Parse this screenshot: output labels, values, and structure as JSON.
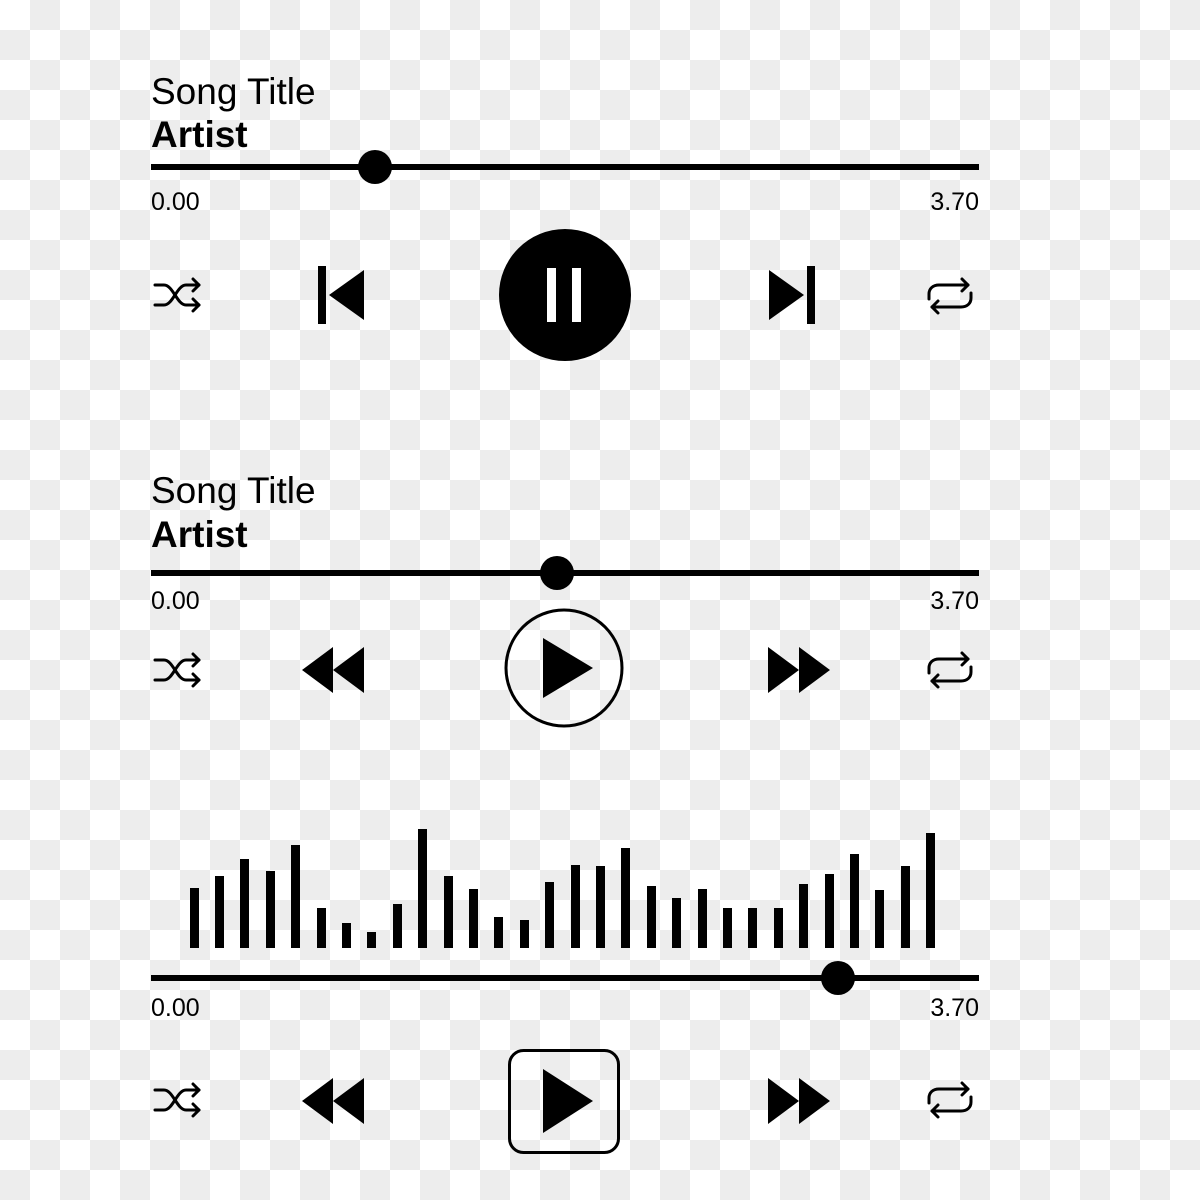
{
  "colors": {
    "ink": "#000000",
    "on_ink": "#ffffff",
    "checker_light": "#ffffff",
    "checker_dark": "#ededed"
  },
  "players": [
    {
      "title": "Song Title",
      "artist": "Artist",
      "time_start": "0.00",
      "time_end": "3.70",
      "progress": 0.27,
      "icons": {
        "shuffle": "shuffle-icon",
        "previous": "skip-previous-icon",
        "main": "pause-icon",
        "next": "skip-next-icon",
        "repeat": "repeat-icon"
      }
    },
    {
      "title": "Song Title",
      "artist": "Artist",
      "time_start": "0.00",
      "time_end": "3.70",
      "progress": 0.49,
      "icons": {
        "shuffle": "shuffle-icon",
        "previous": "rewind-icon",
        "main": "play-circle-icon",
        "next": "fast-forward-icon",
        "repeat": "repeat-icon"
      }
    },
    {
      "time_start": "0.00",
      "time_end": "3.70",
      "progress": 0.83,
      "waveform_levels": [
        0.5,
        0.6,
        0.74,
        0.64,
        0.86,
        0.33,
        0.21,
        0.13,
        0.37,
        0.99,
        0.6,
        0.49,
        0.26,
        0.23,
        0.55,
        0.69,
        0.68,
        0.83,
        0.52,
        0.42,
        0.49,
        0.33,
        0.33,
        0.33,
        0.53,
        0.62,
        0.78,
        0.48,
        0.68,
        0.96
      ],
      "icons": {
        "shuffle": "shuffle-icon",
        "previous": "rewind-icon",
        "main": "play-square-icon",
        "next": "fast-forward-icon",
        "repeat": "repeat-icon"
      }
    }
  ]
}
